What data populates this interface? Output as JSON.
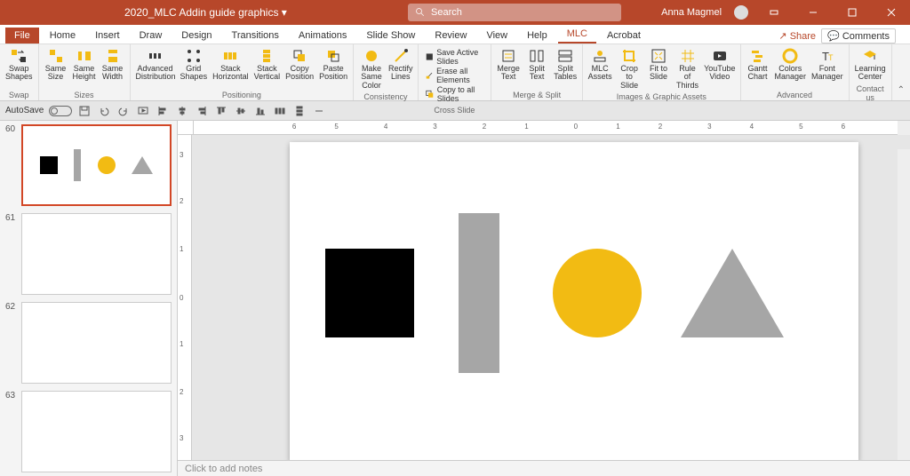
{
  "title_bar": {
    "file_name": "2020_MLC Addin guide graphics ▾",
    "search_placeholder": "Search",
    "user_name": "Anna Magmel"
  },
  "menu_tabs": {
    "file": "File",
    "home": "Home",
    "insert": "Insert",
    "draw": "Draw",
    "design": "Design",
    "transitions": "Transitions",
    "animations": "Animations",
    "slideshow": "Slide Show",
    "review": "Review",
    "view": "View",
    "help": "Help",
    "mlc": "MLC",
    "acrobat": "Acrobat",
    "share": "Share",
    "comments": "Comments"
  },
  "ribbon": {
    "groups": {
      "swap": {
        "label": "Swap",
        "swap_shapes": "Swap\nShapes"
      },
      "sizes": {
        "label": "Sizes",
        "same_size": "Same\nSize",
        "same_height": "Same\nHeight",
        "same_width": "Same\nWidth"
      },
      "positioning": {
        "label": "Positioning",
        "advanced": "Advanced\nDistribution",
        "grid": "Grid\nShapes",
        "stack_h": "Stack\nHorizontal",
        "stack_v": "Stack\nVertical",
        "copy_pos": "Copy\nPosition",
        "paste_pos": "Paste\nPosition"
      },
      "consistency": {
        "label": "Consistency",
        "make_color": "Make\nSame Color",
        "rectify": "Rectify\nLines"
      },
      "cross_slide": {
        "label": "Cross Slide",
        "save_active": "Save Active Slides",
        "erase_all": "Erase all Elements",
        "copy_all": "Copy to all Slides"
      },
      "merge_split": {
        "label": "Merge & Split",
        "merge_text": "Merge\nText",
        "split_text": "Split\nText",
        "split_tables": "Split\nTables"
      },
      "images": {
        "label": "Images & Graphic Assets",
        "mlc_assets": "MLC\nAssets",
        "crop": "Crop to\nSlide",
        "fit": "Fit to\nSlide",
        "rule": "Rule of\nThirds",
        "youtube": "YouTube\nVideo"
      },
      "advanced": {
        "label": "Advanced",
        "gantt": "Gantt\nChart",
        "colors": "Colors\nManager",
        "font": "Font\nManager"
      },
      "contact": {
        "label": "Contact us",
        "learning": "Learning\nCenter"
      }
    }
  },
  "quick": {
    "autosave": "AutoSave"
  },
  "thumbnails": [
    "60",
    "61",
    "62",
    "63"
  ],
  "ruler_h": [
    "6",
    "5",
    "4",
    "3",
    "2",
    "1",
    "0",
    "1",
    "2",
    "3",
    "4",
    "5",
    "6"
  ],
  "ruler_v": [
    "3",
    "2",
    "1",
    "0",
    "1",
    "2",
    "3"
  ],
  "notes": "Click to add notes"
}
